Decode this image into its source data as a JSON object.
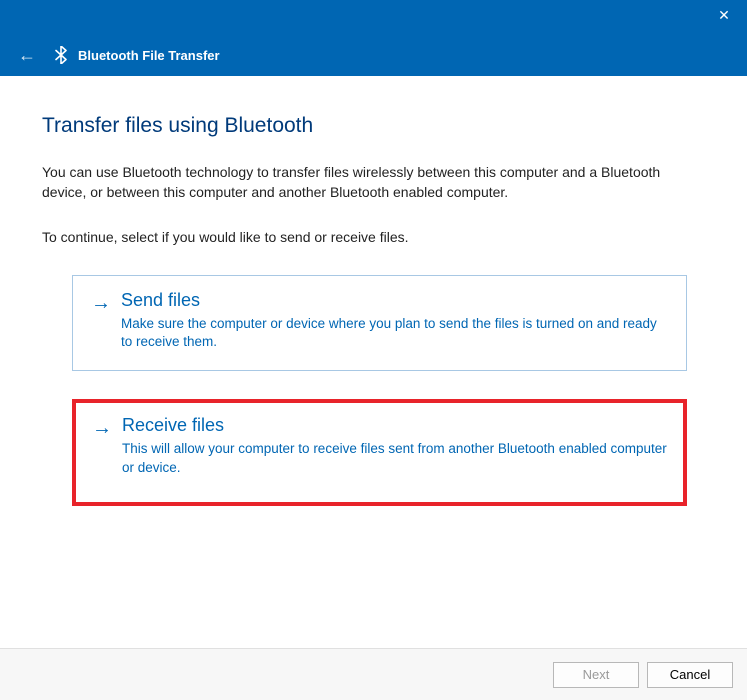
{
  "titlebar": {
    "close_glyph": "✕"
  },
  "header": {
    "back_glyph": "←",
    "title": "Bluetooth File Transfer"
  },
  "page": {
    "title": "Transfer files using Bluetooth",
    "description": "You can use Bluetooth technology to transfer files wirelessly between this computer and a Bluetooth device, or between this computer and another Bluetooth enabled computer.",
    "instruction": "To continue, select if you would like to send or receive files."
  },
  "options": [
    {
      "arrow": "→",
      "title": "Send files",
      "desc": "Make sure the computer or device where you plan to send the files is turned on and ready to receive them."
    },
    {
      "arrow": "→",
      "title": "Receive files",
      "desc": "This will allow your computer to receive files sent from another Bluetooth enabled computer or device."
    }
  ],
  "footer": {
    "next_label": "Next",
    "cancel_label": "Cancel"
  },
  "colors": {
    "accent": "#0066b3",
    "highlight": "#e8232a"
  }
}
